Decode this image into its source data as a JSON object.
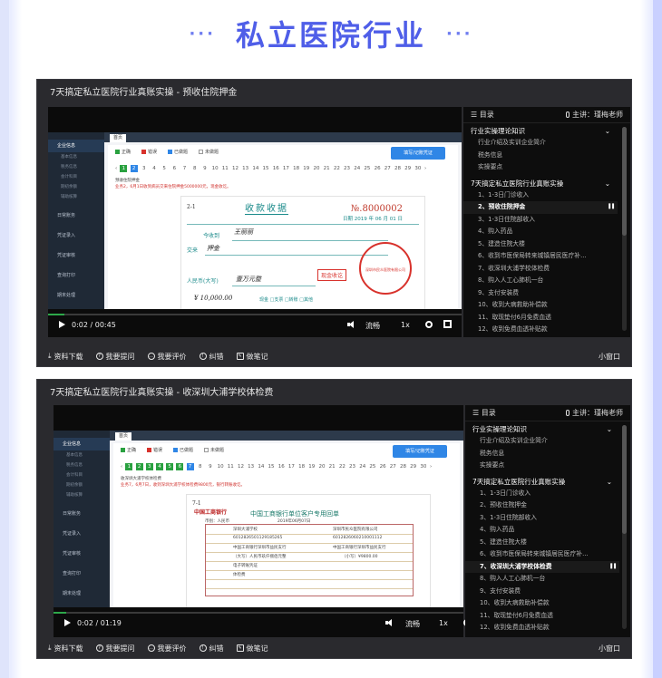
{
  "header": {
    "title": "私立医院行业",
    "dots_left": "···",
    "dots_right": "···"
  },
  "players": [
    {
      "title": "7天搞定私立医院行业真账实操 - 预收住院押金",
      "time": "0:02 / 00:45",
      "progress": 0.04,
      "speed": "流畅",
      "rate": "1x",
      "playlist": {
        "catalog": "目录",
        "teacher": "主讲：瑾梅老师",
        "sections": [
          {
            "title": "行业实操理论知识",
            "items": [
              "行业介绍及实训企业简介",
              "税务信息",
              "实操要点"
            ]
          },
          {
            "title": "7天搞定私立医院行业真账实操",
            "items": [
              "1、1-3日门诊收入",
              "2、预收住院押金",
              "3、1-3日住院部收入",
              "4、购入药品",
              "5、建造住院大楼",
              "6、收到市医保局转来城镇居民医疗补...",
              "7、收深圳大浦学校体检费",
              "8、购入人工心肺机一台",
              "9、支付安装费",
              "10、收到大病救助补偿款",
              "11、取现垫付6月免费血透",
              "12、收到免费血透补贴款"
            ]
          }
        ],
        "active": "2、预收住院押金"
      },
      "screen": {
        "tab": "首页",
        "legend": [
          "正确",
          "错误",
          "已做题",
          "未做题"
        ],
        "button": "填写/记账凭证",
        "steps": [
          "1",
          "2",
          "3",
          "4",
          "5",
          "6",
          "7",
          "8",
          "9",
          "10",
          "11",
          "12",
          "13",
          "14",
          "15",
          "16",
          "17",
          "18",
          "19",
          "20",
          "21",
          "22",
          "23",
          "24",
          "25",
          "26",
          "27",
          "28",
          "29",
          "30"
        ],
        "question_title": "预收住院押金",
        "question_text": "业务2，6月1日收到病员交来住院押金5000000元，现金收讫。",
        "receipt": {
          "title": "收款收据",
          "no": "№.8000002",
          "date": "日期 2019 年 06 月 01 日",
          "payer_label": "今收到",
          "payer": "王丽丽",
          "reason_label": "交来",
          "reason": "押金",
          "amount_label": "人民币(大写)",
          "amount_cn": "壹万元整",
          "amount": "¥ 10,000.00",
          "checks": "现金  □支票  □转账  □其他",
          "stamp": "现金收讫",
          "seal": "深圳市民众医院有限公司",
          "page": "2-1"
        },
        "menu": [
          "企业信息",
          "基本信息",
          "税务信息",
          "会计科目",
          "期初余额",
          "辅助核算",
          "日常账务",
          "凭证录入",
          "凭证审核",
          "查询打印",
          "期末处理"
        ]
      },
      "toolbar": [
        "资料下载",
        "我要提问",
        "我要评价",
        "纠错",
        "做笔记"
      ],
      "mini": "小窗口"
    },
    {
      "title": "7天搞定私立医院行业真账实操 - 收深圳大浦学校体检费",
      "time": "0:02 / 01:19",
      "progress": 0.03,
      "speed": "流畅",
      "rate": "1x",
      "playlist": {
        "catalog": "目录",
        "teacher": "主讲：瑾梅老师",
        "sections": [
          {
            "title": "行业实操理论知识",
            "items": [
              "行业介绍及实训企业简介",
              "税务信息",
              "实操要点"
            ]
          },
          {
            "title": "7天搞定私立医院行业真账实操",
            "items": [
              "1、1-3日门诊收入",
              "2、预收住院押金",
              "3、1-3日住院部收入",
              "4、购入药品",
              "5、建造住院大楼",
              "6、收到市医保局转来城镇居民医疗补...",
              "7、收深圳大浦学校体检费",
              "8、购入人工心肺机一台",
              "9、支付安装费",
              "10、收到大病救助补偿款",
              "11、取现垫付6月免费血透",
              "12、收到免费血透补贴款"
            ]
          }
        ],
        "active": "7、收深圳大浦学校体检费"
      },
      "screen": {
        "tab": "首页",
        "legend": [
          "正确",
          "错误",
          "已做题",
          "未做题"
        ],
        "button": "填写/记账凭证",
        "steps": [
          "1",
          "2",
          "3",
          "4",
          "5",
          "6",
          "7",
          "8",
          "9",
          "10",
          "11",
          "12",
          "13",
          "14",
          "15",
          "16",
          "17",
          "18",
          "19",
          "20",
          "21",
          "22",
          "23",
          "24",
          "25",
          "26",
          "27",
          "28",
          "29",
          "30"
        ],
        "question_title": "收深圳大浦学校体检费",
        "question_text": "业务7，6月7日，收到深圳大浦学校体检费9800元，银行转账收讫。",
        "bank": {
          "logo": "中国工商银行",
          "title": "中国工商银行单位客户专用回单",
          "currency": "币别：人民币",
          "date": "2019年06月07日",
          "payer": "深圳大浦学校",
          "payee": "深圳市民众医院有限公司",
          "account1": "6012826501129185265",
          "account2": "6012826060210001112",
          "bank1": "中国工商银行深圳市益民支行",
          "bank2": "中国工商银行深圳市益民支行",
          "amount_cn": "（大写）人民币玖仟捌佰元整",
          "amount": "（小写）¥9800.00",
          "voucher": "电子转账凭证",
          "purpose": "体检费",
          "page": "7-1"
        },
        "menu": [
          "企业信息",
          "基本信息",
          "税务信息",
          "会计科目",
          "期初余额",
          "辅助核算",
          "日常账务",
          "凭证录入",
          "凭证审核",
          "查询打印",
          "期末处理"
        ]
      },
      "toolbar": [
        "资料下载",
        "我要提问",
        "我要评价",
        "纠错",
        "做笔记"
      ],
      "mini": "小窗口"
    }
  ],
  "colors": {
    "accent": "#4f5ee8",
    "green": "#2aa140",
    "blue": "#2f86e6",
    "red": "#d8322c"
  }
}
